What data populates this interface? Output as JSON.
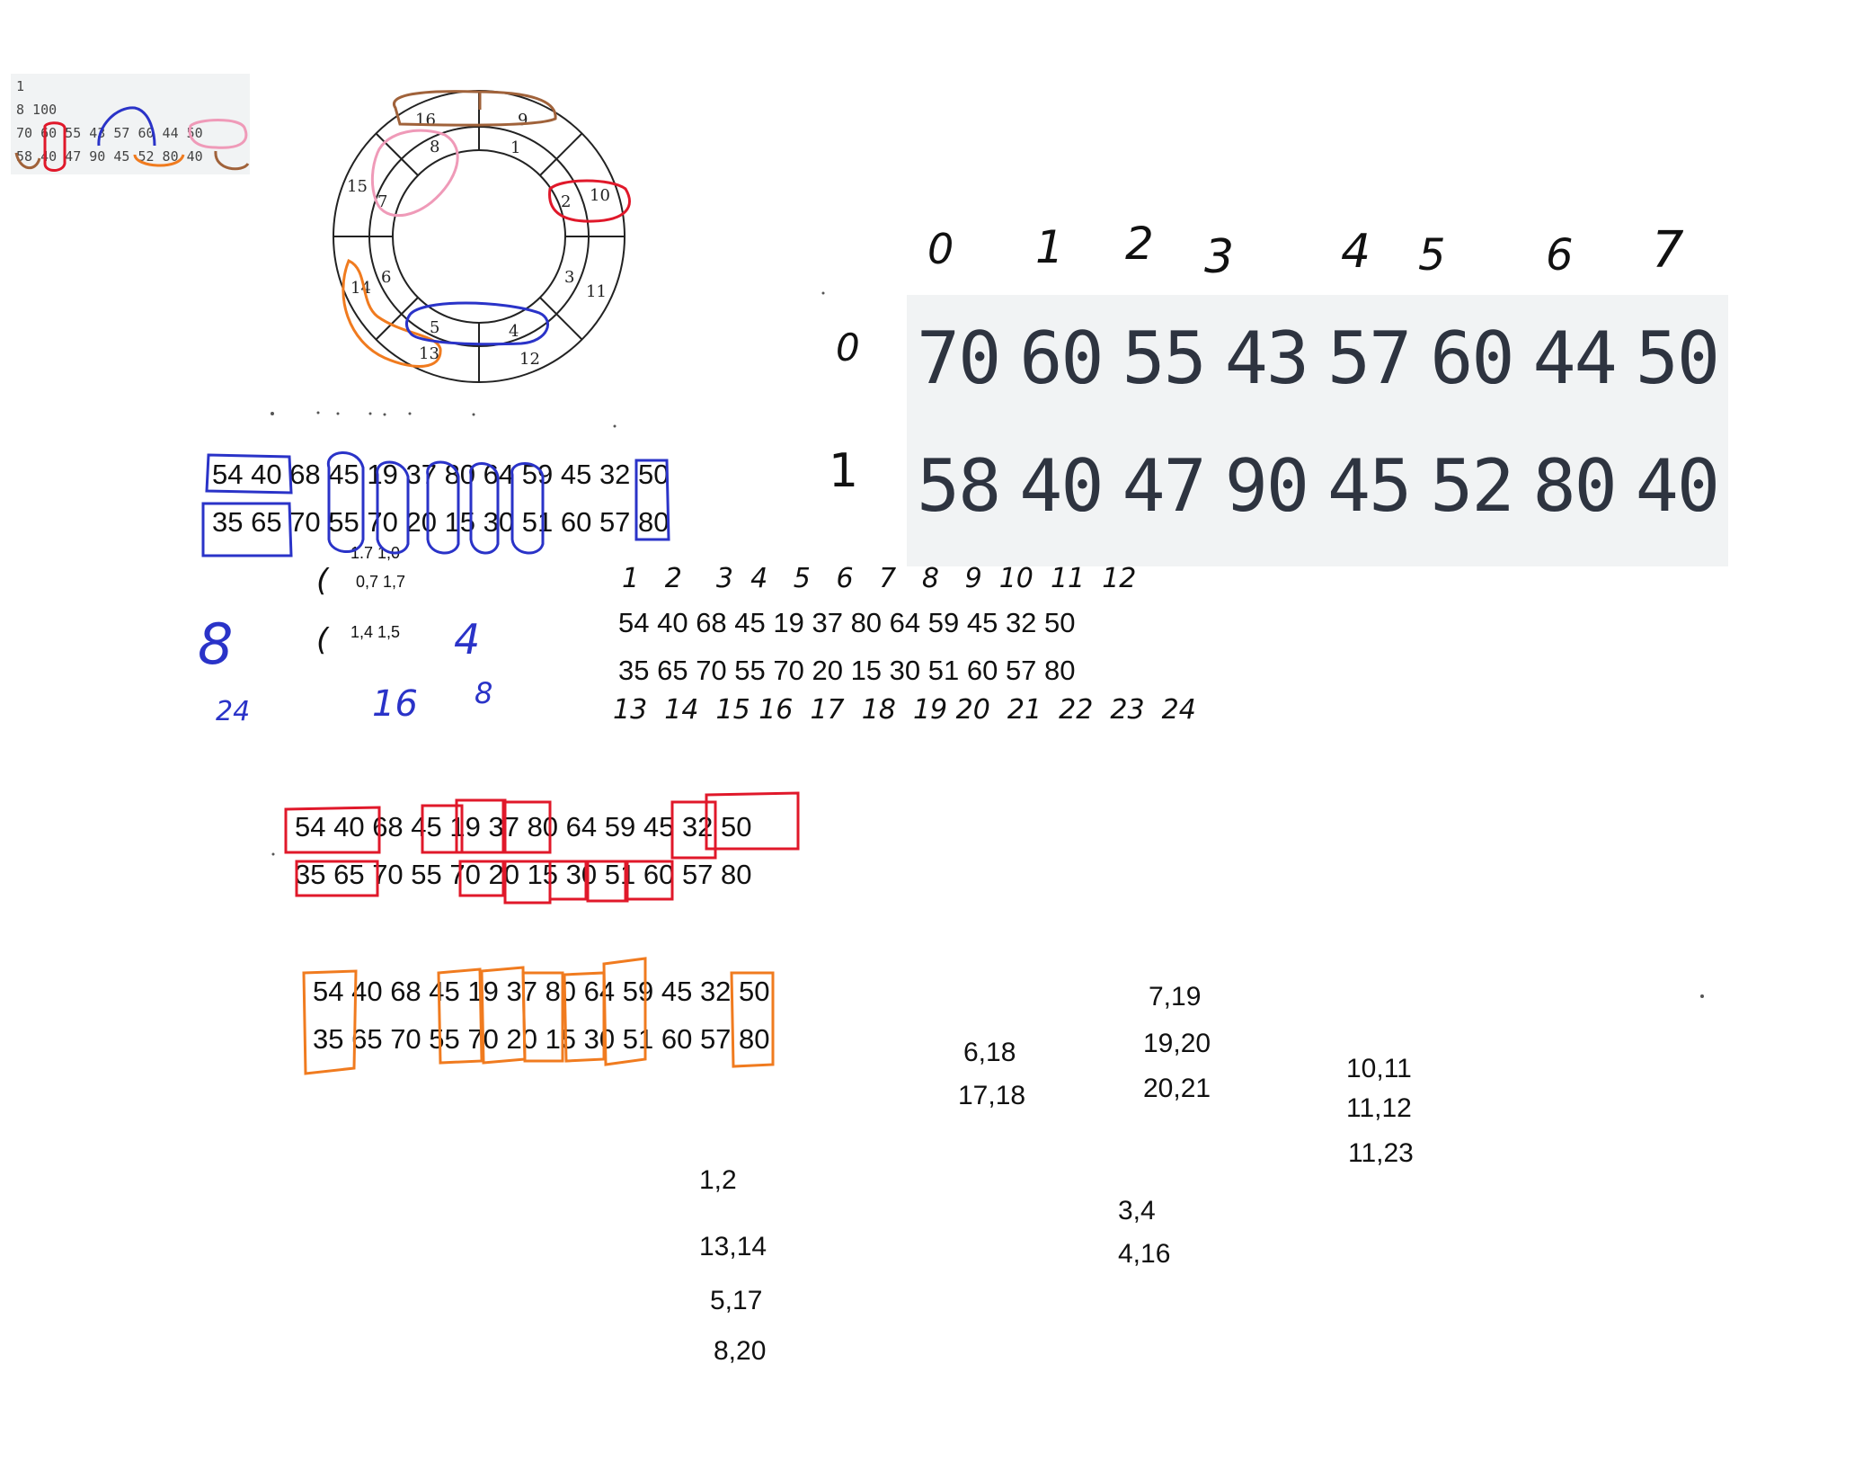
{
  "snippet": {
    "lines": [
      "1",
      "8 100",
      "70 60 55 43 57 60 44 50",
      "58 40 47 90 45 52 80 40"
    ]
  },
  "wheel": {
    "outer_labels": [
      "16",
      "9",
      "15",
      "10",
      "11",
      "12",
      "13",
      "14"
    ],
    "inner_labels": [
      "8",
      "1",
      "7",
      "2",
      "3",
      "4",
      "5",
      "6"
    ]
  },
  "big_table": {
    "col_headers": [
      "0",
      "1",
      "2",
      "3",
      "4",
      "5",
      "6",
      "7"
    ],
    "row_headers": [
      "0",
      "1"
    ],
    "row0": [
      "70",
      "60",
      "55",
      "43",
      "57",
      "60",
      "44",
      "50"
    ],
    "row1": [
      "58",
      "40",
      "47",
      "90",
      "45",
      "52",
      "80",
      "40"
    ]
  },
  "blocks": {
    "top_line": "54 40 68 45 19 37 80 64 59 45 32 50",
    "bottom_line": "35 65 70 55 70 20 15 30 51 60 57 80"
  },
  "notes": {
    "n1": "1.7 1,0",
    "n2": "0,7 1,7",
    "n3": "1,4 1,5",
    "one_a": "(",
    "one_b": "(",
    "blue_8": "8",
    "blue_4": "4",
    "blue_24": "24",
    "blue_16": "16",
    "blue_8b": "8"
  },
  "numbered": {
    "top_indices": "1   2    3  4   5   6   7   8   9  10  11  12",
    "bottom_indices": "13  14  15 16  17  18  19 20  21  22  23  24"
  },
  "pairs": {
    "col1": [
      "1,2",
      "13,14",
      "5,17",
      "8,20"
    ],
    "col2": [
      "6,18",
      "17,18"
    ],
    "col3": [
      "7,19",
      "19,20",
      "20,21"
    ],
    "col4": [
      "3,4",
      "4,16"
    ],
    "col5": [
      "10,11",
      "11,12",
      "11,23"
    ]
  }
}
